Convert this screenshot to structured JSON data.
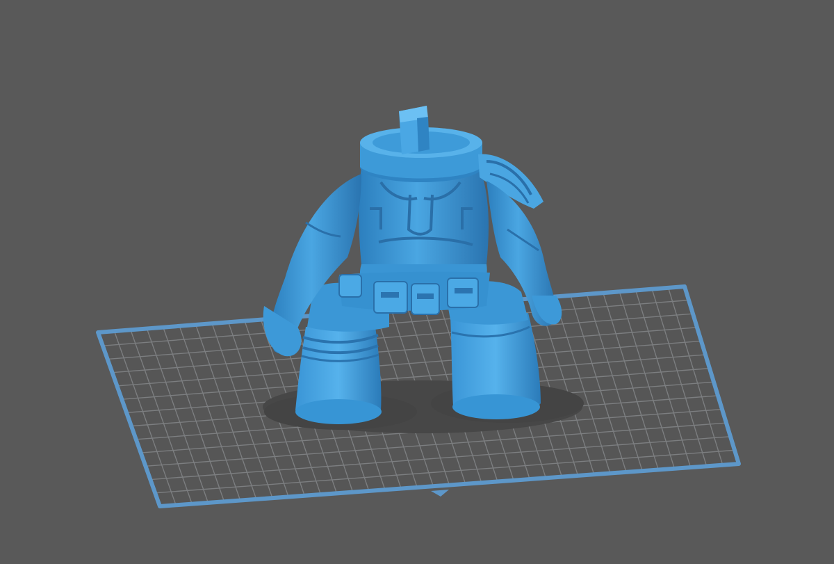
{
  "viewport": {
    "background": "#595959",
    "build_plate": {
      "grid_color": "#7d7f82",
      "border_color": "#5d97c9",
      "surface_color": "#575757"
    },
    "model": {
      "color": "#3d9ad8",
      "highlight": "#6dbcef",
      "shade": "#2a78b4"
    }
  }
}
